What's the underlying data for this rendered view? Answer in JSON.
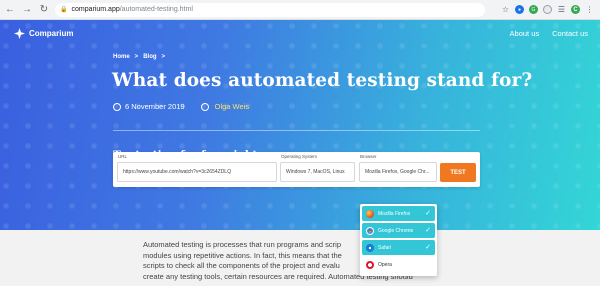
{
  "browser": {
    "url_host": "comparium.app",
    "url_path": "/automated-testing.html",
    "avatar_letter": "C"
  },
  "header": {
    "logo_text": "Comparium",
    "nav": [
      "About us",
      "Contact us"
    ]
  },
  "hero": {
    "breadcrumb": [
      "Home",
      ">",
      "Blog",
      ">"
    ],
    "title": "What does automated testing stand  for?",
    "date": "6 November 2019",
    "author": "Olga Weis",
    "cta": "Try testing for free right now."
  },
  "form": {
    "url_label": "URL",
    "url_value": "https://www.youtube.com/watch?v=3c2654ZDLQ",
    "os_label": "Operating System",
    "os_value": "Windows 7, MacOS, Linux",
    "browser_label": "Browser",
    "browser_value": "Mozilla Firefox, Google Chr...",
    "test_label": "TEST"
  },
  "browser_options": [
    {
      "label": "Mozilla Firefox",
      "selected": true,
      "icon": "firefox-icon"
    },
    {
      "label": "Google Chrome",
      "selected": true,
      "icon": "chrome-icon"
    },
    {
      "label": "Safari",
      "selected": true,
      "icon": "safari-icon"
    },
    {
      "label": "Opera",
      "selected": false,
      "icon": "opera-icon"
    }
  ],
  "content": {
    "lines": [
      "Automated testing is processes that run programs and scrip",
      "modules using repetitive actions. In fact, this means that the",
      "scripts to check all the components of the project and evalu",
      "create any testing tools, certain resources are required. Automated testing should"
    ]
  },
  "colors": {
    "hero_start": "#3a5fe0",
    "hero_end": "#33d6d6",
    "accent": "#f07820",
    "selected_option": "#33c6d6",
    "author": "#ffe066"
  }
}
